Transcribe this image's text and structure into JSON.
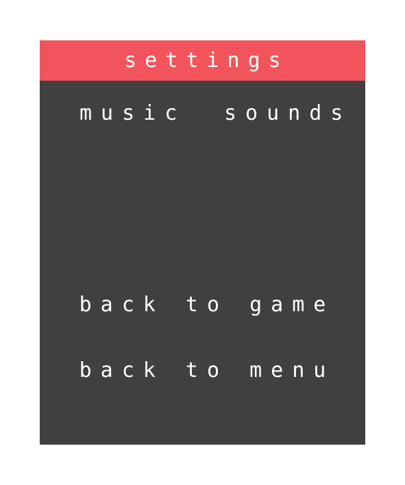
{
  "header": {
    "title": "settings"
  },
  "settings": {
    "music_label": "music",
    "sounds_label": "sounds"
  },
  "actions": {
    "back_to_game": "back to game",
    "back_to_menu": "back to menu"
  },
  "colors": {
    "header_bg": "#f2545b",
    "panel_bg": "#404040",
    "text": "#ffffff",
    "page_bg": "#ffffff"
  }
}
